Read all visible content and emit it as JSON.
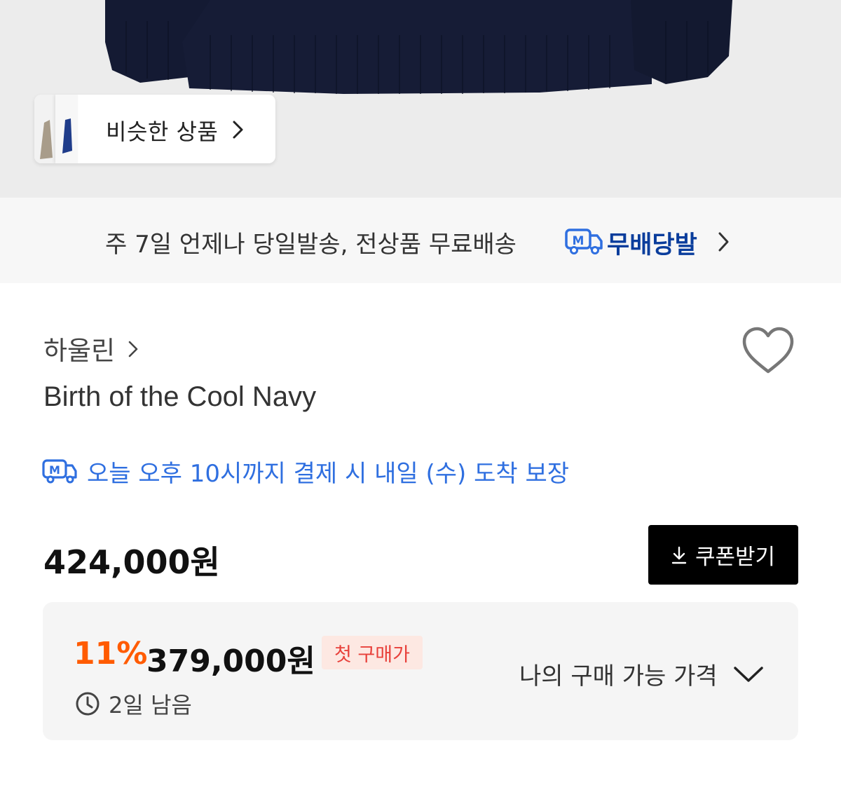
{
  "hero": {
    "similar_label": "비슷한 상품"
  },
  "shipping_banner": {
    "text": "주 7일 언제나 당일발송, 전상품 무료배송",
    "brand": "무배당발",
    "logo_letter": "M"
  },
  "product": {
    "brand": "하울린",
    "name": "Birth of the Cool Navy",
    "delivery_text": "오늘 오후 10시까지 결제 시 내일 (수) 도착 보장",
    "price": "424,000원",
    "coupon_label": "쿠폰받기"
  },
  "discount": {
    "percent": "11%",
    "price": "379,000원",
    "badge": "첫 구매가",
    "remaining": "2일 남음",
    "available_label": "나의 구매 가능 가격"
  },
  "colors": {
    "sweater": "#141a33",
    "accent_blue": "#2f6fe0",
    "brand_navy": "#0a3d9c",
    "discount_orange": "#ff5b00",
    "badge_red": "#e8413b",
    "badge_bg": "#fde8e2"
  }
}
